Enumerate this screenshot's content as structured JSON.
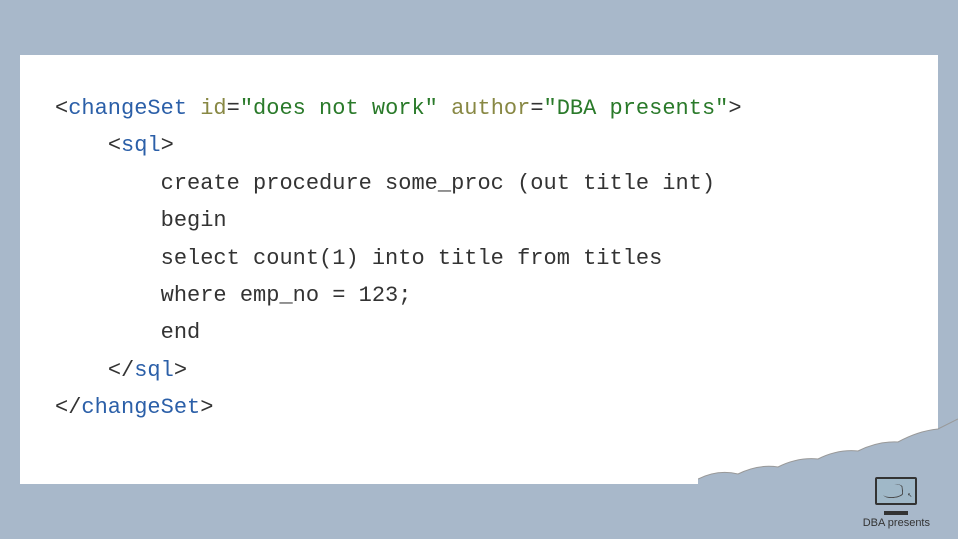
{
  "code": {
    "line1": {
      "open": "<",
      "tag": "changeSet",
      "attr1_name": "id",
      "attr1_eq": "=",
      "attr1_val": "\"does not work\"",
      "attr2_name": "author",
      "attr2_eq": "=",
      "attr2_val": "\"DBA presents\"",
      "close": ">"
    },
    "line2": {
      "indent": "    ",
      "open": "<",
      "tag": "sql",
      "close": ">"
    },
    "line3": {
      "indent": "        ",
      "text": "create procedure some_proc (out title int)"
    },
    "line4": {
      "indent": "        ",
      "text": "begin"
    },
    "line5": {
      "indent": "        ",
      "text": "select count(1) into title from titles"
    },
    "line6": {
      "indent": "        ",
      "text": "where emp_no = 123;"
    },
    "line7": {
      "indent": "        ",
      "text": "end"
    },
    "line8": {
      "indent": "    ",
      "open": "</",
      "tag": "sql",
      "close": ">"
    },
    "line9": {
      "open": "</",
      "tag": "changeSet",
      "close": ">"
    }
  },
  "logo": {
    "text": "DBA presents"
  }
}
